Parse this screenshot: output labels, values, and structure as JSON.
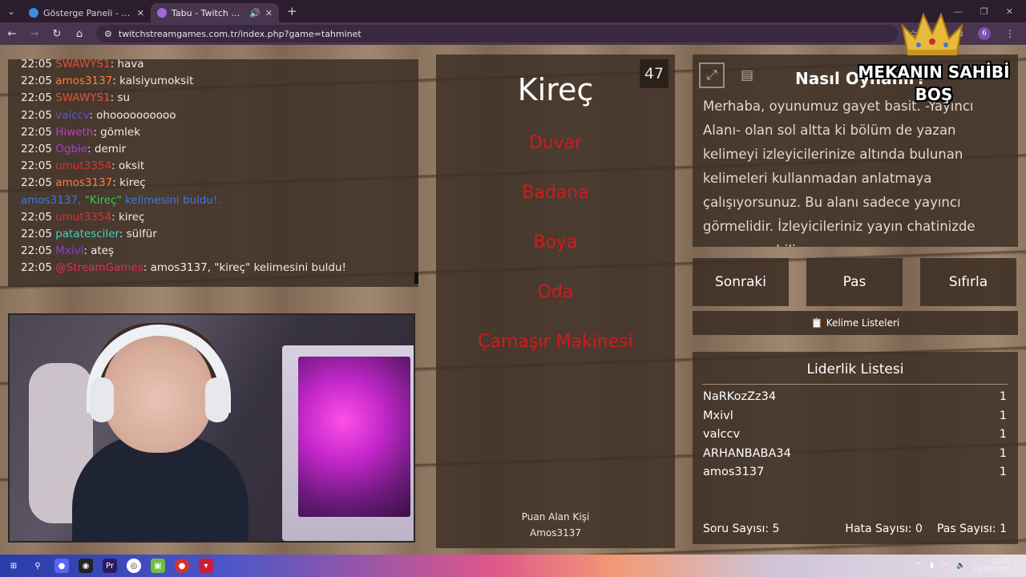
{
  "browser": {
    "tabs": [
      {
        "title": "Gösterge Paneli - MissXss AI Bo"
      },
      {
        "title": "Tabu - Twitch Stream Game"
      }
    ],
    "new_tab": "+",
    "url": "twitchstreamgames.com.tr/index.php?game=tahminet",
    "profile_initial": "6"
  },
  "chat": {
    "lines": [
      {
        "time": "22:05",
        "user": "SWAWYS1",
        "user_color": "#e0503a",
        "text": ": hava"
      },
      {
        "time": "22:05",
        "user": "amos3137",
        "user_color": "#ff7b3a",
        "text": ": kalsiyumoksit"
      },
      {
        "time": "22:05",
        "user": "SWAWYS1",
        "user_color": "#e0503a",
        "text": ": su"
      },
      {
        "time": "22:05",
        "user": "valccv",
        "user_color": "#5a55d6",
        "text": ": ohoooooooooo"
      },
      {
        "time": "22:05",
        "user": "Hiweth",
        "user_color": "#c03ad6",
        "text": ": gömlek"
      },
      {
        "time": "22:05",
        "user": "Ogbie",
        "user_color": "#a042d8",
        "text": ": demir"
      },
      {
        "time": "22:05",
        "user": "umut3354",
        "user_color": "#e03030",
        "text": ": oksit"
      },
      {
        "time": "22:05",
        "user": "amos3137",
        "user_color": "#ff7b3a",
        "text": ": kireç"
      }
    ],
    "found_notice": {
      "pre": "amos3137, ",
      "word": "\"Kireç\"",
      "post": " kelimesini buldu!."
    },
    "lines2": [
      {
        "time": "22:05",
        "user": "umut3354",
        "user_color": "#e03030",
        "text": ": kireç"
      },
      {
        "time": "22:05",
        "user": "patatesciler",
        "user_color": "#3ad6c8",
        "text": ": sülfür"
      },
      {
        "time": "22:05",
        "user": "Mxivl",
        "user_color": "#8a3ad6",
        "text": ": ateş"
      },
      {
        "time": "22:05",
        "user": "@StreamGames",
        "user_color": "#e03050",
        "text": ": amos3137, \"kireç\" kelimesini buldu!"
      }
    ]
  },
  "card": {
    "timer": "47",
    "word": "Kireç",
    "taboo_words": [
      "Duvar",
      "Badana",
      "Boya",
      "Oda",
      "Çamaşır Makinesi"
    ],
    "scorer_label": "Puan Alan Kişi",
    "scorer_name": "Amos3137"
  },
  "howto": {
    "title": "Nasıl Oynanır?",
    "text": "Merhaba, oyunumuz gayet basit. -Yayıncı Alanı- olan sol altta ki bölüm de yazan kelimeyi izleyicilerinize altında bulunan kelimeleri kullanmadan anlatmaya çalışıyorsunuz. Bu alanı sadece yayıncı görmelidir. İzleyicileriniz yayın chatinizde cevap verebilir."
  },
  "buttons": {
    "next": "Sonraki",
    "pass": "Pas",
    "reset": "Sıfırla",
    "word_lists": "Kelime Listeleri"
  },
  "leaderboard": {
    "title": "Liderlik Listesi",
    "rows": [
      {
        "name": "NaRKozZz34",
        "score": "1"
      },
      {
        "name": "Mxivl",
        "score": "1"
      },
      {
        "name": "valccv",
        "score": "1"
      },
      {
        "name": "ARHANBABA34",
        "score": "1"
      },
      {
        "name": "amos3137",
        "score": "1"
      }
    ],
    "question_count": "Soru Sayısı: 5",
    "error_count": "Hata Sayısı: 0",
    "pass_count": "Pas Sayısı: 1"
  },
  "overlay": {
    "owner_title": "MEKANIN SAHİBİ",
    "owner_name": "BOŞ"
  },
  "taskbar": {
    "time": "22:05",
    "date": "29.08.2025"
  }
}
